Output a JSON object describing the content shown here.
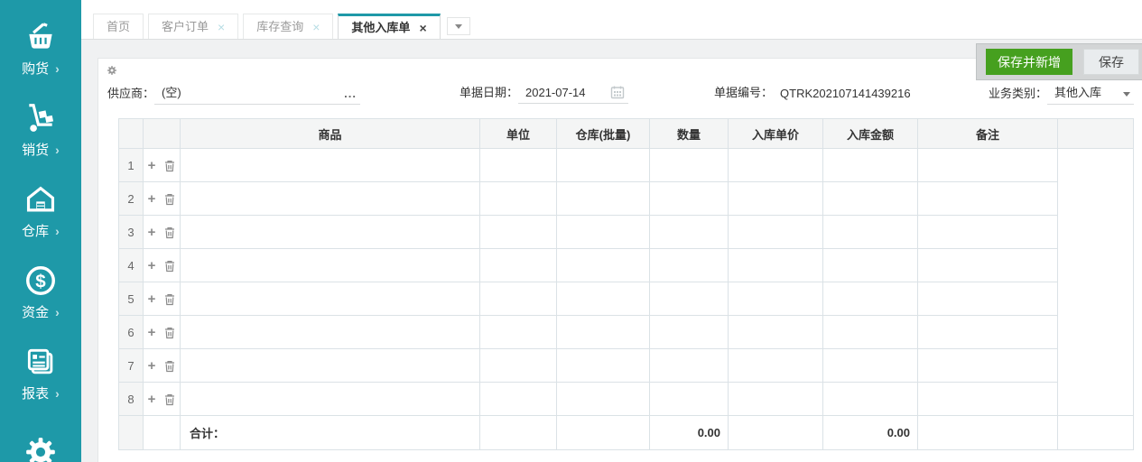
{
  "colors": {
    "accent_teal": "#1e99a8",
    "button_green": "#46a01f"
  },
  "sidebar": {
    "arrow": "›",
    "items": [
      {
        "label": "购货",
        "icon": "purchase-basket-icon"
      },
      {
        "label": "销货",
        "icon": "sales-cart-icon"
      },
      {
        "label": "仓库",
        "icon": "warehouse-icon"
      },
      {
        "label": "资金",
        "icon": "funds-icon"
      },
      {
        "label": "报表",
        "icon": "report-icon"
      }
    ]
  },
  "tabs": {
    "close_glyph": "×",
    "items": [
      {
        "label": "首页",
        "closable": false,
        "active": false
      },
      {
        "label": "客户订单",
        "closable": true,
        "active": false
      },
      {
        "label": "库存查询",
        "closable": true,
        "active": false
      },
      {
        "label": "其他入库单",
        "closable": true,
        "active": true
      }
    ]
  },
  "toolbar": {
    "save_and_new": "保存并新增",
    "save": "保存"
  },
  "form": {
    "supplier_label": "供应商：",
    "supplier_value": "(空)",
    "supplier_more": "...",
    "date_label": "单据日期：",
    "date_value": "2021-07-14",
    "number_label": "单据编号：",
    "number_value": "QTRK202107141439216",
    "biz_type_label": "业务类别：",
    "biz_type_value": "其他入库"
  },
  "table": {
    "headers": [
      "",
      "",
      "商品",
      "单位",
      "仓库(批量)",
      "数量",
      "入库单价",
      "入库金额",
      "备注",
      ""
    ],
    "rows": [
      {
        "no": "1"
      },
      {
        "no": "2"
      },
      {
        "no": "3"
      },
      {
        "no": "4"
      },
      {
        "no": "5"
      },
      {
        "no": "6"
      },
      {
        "no": "7"
      },
      {
        "no": "8"
      }
    ],
    "footer": {
      "label": "合计：",
      "qty_total": "0.00",
      "amount_total": "0.00"
    }
  }
}
